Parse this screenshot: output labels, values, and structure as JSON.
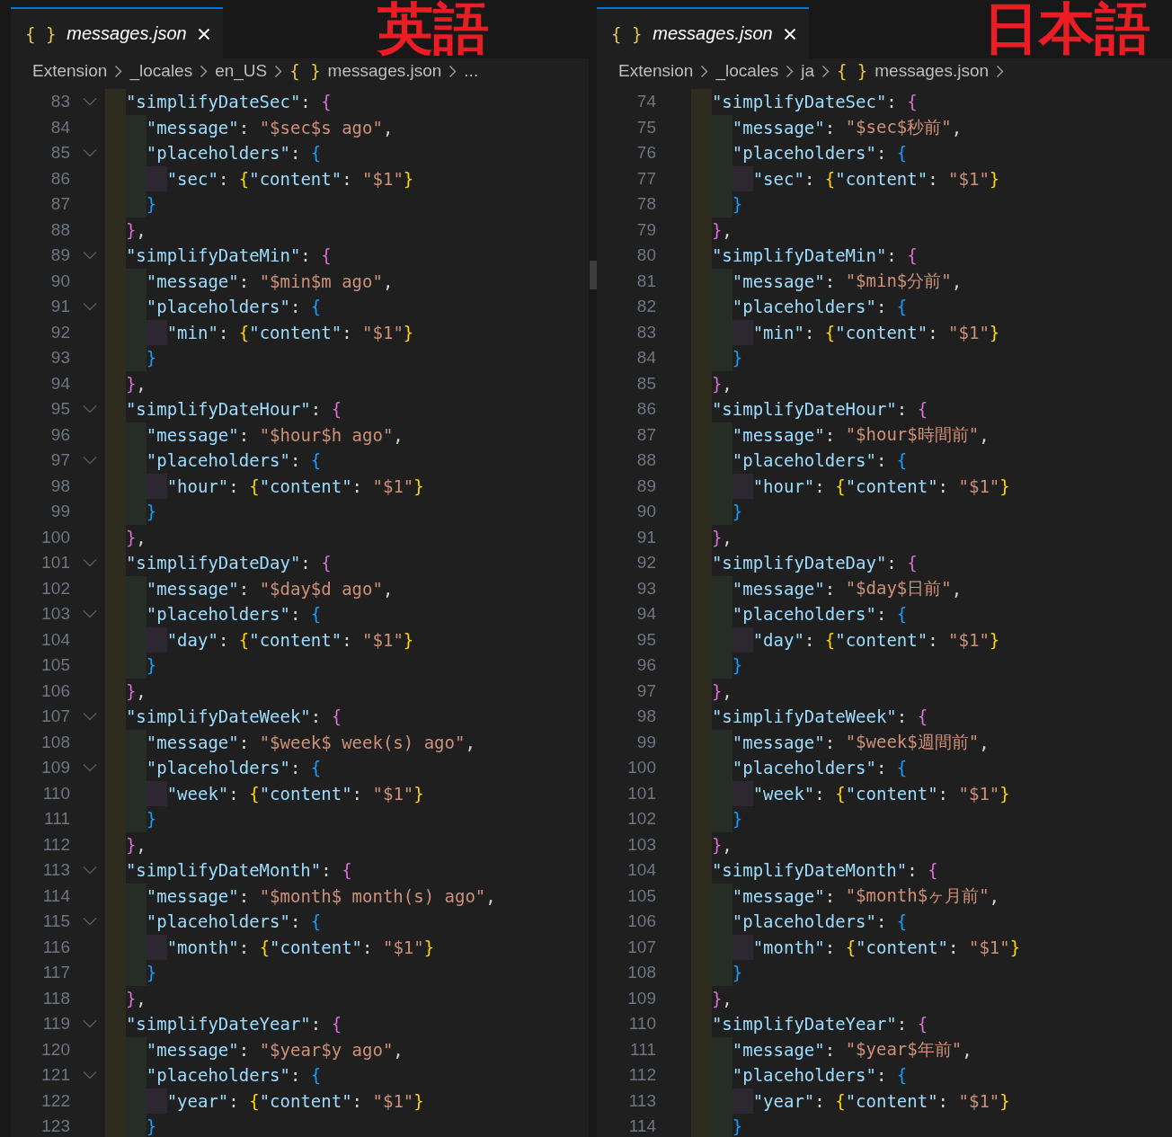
{
  "panes": [
    {
      "annotation": "英語",
      "tab": {
        "icon": "{ }",
        "title": "messages.json",
        "selected": true
      },
      "breadcrumbs": [
        {
          "text": "Extension"
        },
        {
          "text": "_locales"
        },
        {
          "text": "en_US"
        },
        {
          "icon": "{ }",
          "text": "messages.json"
        },
        {
          "text": "..."
        }
      ],
      "trailing_separator": false,
      "lines": [
        {
          "number": "83",
          "text": "  \"simplifyDateSec\": {",
          "foldable": true
        },
        {
          "number": "84",
          "text": "    \"message\": \"$sec$s ago\",",
          "foldable": false
        },
        {
          "number": "85",
          "text": "    \"placeholders\": {",
          "foldable": true
        },
        {
          "number": "86",
          "text": "      \"sec\": {\"content\": \"$1\"}",
          "foldable": false
        },
        {
          "number": "87",
          "text": "    }",
          "foldable": false
        },
        {
          "number": "88",
          "text": "  },",
          "foldable": false
        },
        {
          "number": "89",
          "text": "  \"simplifyDateMin\": {",
          "foldable": true
        },
        {
          "number": "90",
          "text": "    \"message\": \"$min$m ago\",",
          "foldable": false
        },
        {
          "number": "91",
          "text": "    \"placeholders\": {",
          "foldable": true
        },
        {
          "number": "92",
          "text": "      \"min\": {\"content\": \"$1\"}",
          "foldable": false
        },
        {
          "number": "93",
          "text": "    }",
          "foldable": false
        },
        {
          "number": "94",
          "text": "  },",
          "foldable": false
        },
        {
          "number": "95",
          "text": "  \"simplifyDateHour\": {",
          "foldable": true
        },
        {
          "number": "96",
          "text": "    \"message\": \"$hour$h ago\",",
          "foldable": false
        },
        {
          "number": "97",
          "text": "    \"placeholders\": {",
          "foldable": true
        },
        {
          "number": "98",
          "text": "      \"hour\": {\"content\": \"$1\"}",
          "foldable": false
        },
        {
          "number": "99",
          "text": "    }",
          "foldable": false
        },
        {
          "number": "100",
          "text": "  },",
          "foldable": false
        },
        {
          "number": "101",
          "text": "  \"simplifyDateDay\": {",
          "foldable": true
        },
        {
          "number": "102",
          "text": "    \"message\": \"$day$d ago\",",
          "foldable": false
        },
        {
          "number": "103",
          "text": "    \"placeholders\": {",
          "foldable": true
        },
        {
          "number": "104",
          "text": "      \"day\": {\"content\": \"$1\"}",
          "foldable": false
        },
        {
          "number": "105",
          "text": "    }",
          "foldable": false
        },
        {
          "number": "106",
          "text": "  },",
          "foldable": false
        },
        {
          "number": "107",
          "text": "  \"simplifyDateWeek\": {",
          "foldable": true
        },
        {
          "number": "108",
          "text": "    \"message\": \"$week$ week(s) ago\",",
          "foldable": false
        },
        {
          "number": "109",
          "text": "    \"placeholders\": {",
          "foldable": true
        },
        {
          "number": "110",
          "text": "      \"week\": {\"content\": \"$1\"}",
          "foldable": false
        },
        {
          "number": "111",
          "text": "    }",
          "foldable": false
        },
        {
          "number": "112",
          "text": "  },",
          "foldable": false
        },
        {
          "number": "113",
          "text": "  \"simplifyDateMonth\": {",
          "foldable": true
        },
        {
          "number": "114",
          "text": "    \"message\": \"$month$ month(s) ago\",",
          "foldable": false
        },
        {
          "number": "115",
          "text": "    \"placeholders\": {",
          "foldable": true
        },
        {
          "number": "116",
          "text": "      \"month\": {\"content\": \"$1\"}",
          "foldable": false
        },
        {
          "number": "117",
          "text": "    }",
          "foldable": false
        },
        {
          "number": "118",
          "text": "  },",
          "foldable": false
        },
        {
          "number": "119",
          "text": "  \"simplifyDateYear\": {",
          "foldable": true
        },
        {
          "number": "120",
          "text": "    \"message\": \"$year$y ago\",",
          "foldable": false
        },
        {
          "number": "121",
          "text": "    \"placeholders\": {",
          "foldable": true
        },
        {
          "number": "122",
          "text": "      \"year\": {\"content\": \"$1\"}",
          "foldable": false
        },
        {
          "number": "123",
          "text": "    }",
          "foldable": false
        }
      ]
    },
    {
      "annotation": "日本語",
      "tab": {
        "icon": "{ }",
        "title": "messages.json",
        "selected": true
      },
      "breadcrumbs": [
        {
          "text": "Extension"
        },
        {
          "text": "_locales"
        },
        {
          "text": "ja"
        },
        {
          "icon": "{ }",
          "text": "messages.json"
        }
      ],
      "trailing_separator": true,
      "lines": [
        {
          "number": "74",
          "text": "  \"simplifyDateSec\": {",
          "foldable": false
        },
        {
          "number": "75",
          "text": "    \"message\": \"$sec$秒前\",",
          "foldable": false
        },
        {
          "number": "76",
          "text": "    \"placeholders\": {",
          "foldable": false
        },
        {
          "number": "77",
          "text": "      \"sec\": {\"content\": \"$1\"}",
          "foldable": false
        },
        {
          "number": "78",
          "text": "    }",
          "foldable": false
        },
        {
          "number": "79",
          "text": "  },",
          "foldable": false
        },
        {
          "number": "80",
          "text": "  \"simplifyDateMin\": {",
          "foldable": false
        },
        {
          "number": "81",
          "text": "    \"message\": \"$min$分前\",",
          "foldable": false
        },
        {
          "number": "82",
          "text": "    \"placeholders\": {",
          "foldable": false
        },
        {
          "number": "83",
          "text": "      \"min\": {\"content\": \"$1\"}",
          "foldable": false
        },
        {
          "number": "84",
          "text": "    }",
          "foldable": false
        },
        {
          "number": "85",
          "text": "  },",
          "foldable": false
        },
        {
          "number": "86",
          "text": "  \"simplifyDateHour\": {",
          "foldable": false
        },
        {
          "number": "87",
          "text": "    \"message\": \"$hour$時間前\",",
          "foldable": false
        },
        {
          "number": "88",
          "text": "    \"placeholders\": {",
          "foldable": false
        },
        {
          "number": "89",
          "text": "      \"hour\": {\"content\": \"$1\"}",
          "foldable": false
        },
        {
          "number": "90",
          "text": "    }",
          "foldable": false
        },
        {
          "number": "91",
          "text": "  },",
          "foldable": false
        },
        {
          "number": "92",
          "text": "  \"simplifyDateDay\": {",
          "foldable": false
        },
        {
          "number": "93",
          "text": "    \"message\": \"$day$日前\",",
          "foldable": false
        },
        {
          "number": "94",
          "text": "    \"placeholders\": {",
          "foldable": false
        },
        {
          "number": "95",
          "text": "      \"day\": {\"content\": \"$1\"}",
          "foldable": false
        },
        {
          "number": "96",
          "text": "    }",
          "foldable": false
        },
        {
          "number": "97",
          "text": "  },",
          "foldable": false
        },
        {
          "number": "98",
          "text": "  \"simplifyDateWeek\": {",
          "foldable": false
        },
        {
          "number": "99",
          "text": "    \"message\": \"$week$週間前\",",
          "foldable": false
        },
        {
          "number": "100",
          "text": "    \"placeholders\": {",
          "foldable": false
        },
        {
          "number": "101",
          "text": "      \"week\": {\"content\": \"$1\"}",
          "foldable": false
        },
        {
          "number": "102",
          "text": "    }",
          "foldable": false
        },
        {
          "number": "103",
          "text": "  },",
          "foldable": false
        },
        {
          "number": "104",
          "text": "  \"simplifyDateMonth\": {",
          "foldable": false
        },
        {
          "number": "105",
          "text": "    \"message\": \"$month$ヶ月前\",",
          "foldable": false
        },
        {
          "number": "106",
          "text": "    \"placeholders\": {",
          "foldable": false
        },
        {
          "number": "107",
          "text": "      \"month\": {\"content\": \"$1\"}",
          "foldable": false
        },
        {
          "number": "108",
          "text": "    }",
          "foldable": false
        },
        {
          "number": "109",
          "text": "  },",
          "foldable": false
        },
        {
          "number": "110",
          "text": "  \"simplifyDateYear\": {",
          "foldable": false
        },
        {
          "number": "111",
          "text": "    \"message\": \"$year$年前\",",
          "foldable": false
        },
        {
          "number": "112",
          "text": "    \"placeholders\": {",
          "foldable": false
        },
        {
          "number": "113",
          "text": "      \"year\": {\"content\": \"$1\"}",
          "foldable": false
        },
        {
          "number": "114",
          "text": "    }",
          "foldable": false
        }
      ]
    }
  ]
}
